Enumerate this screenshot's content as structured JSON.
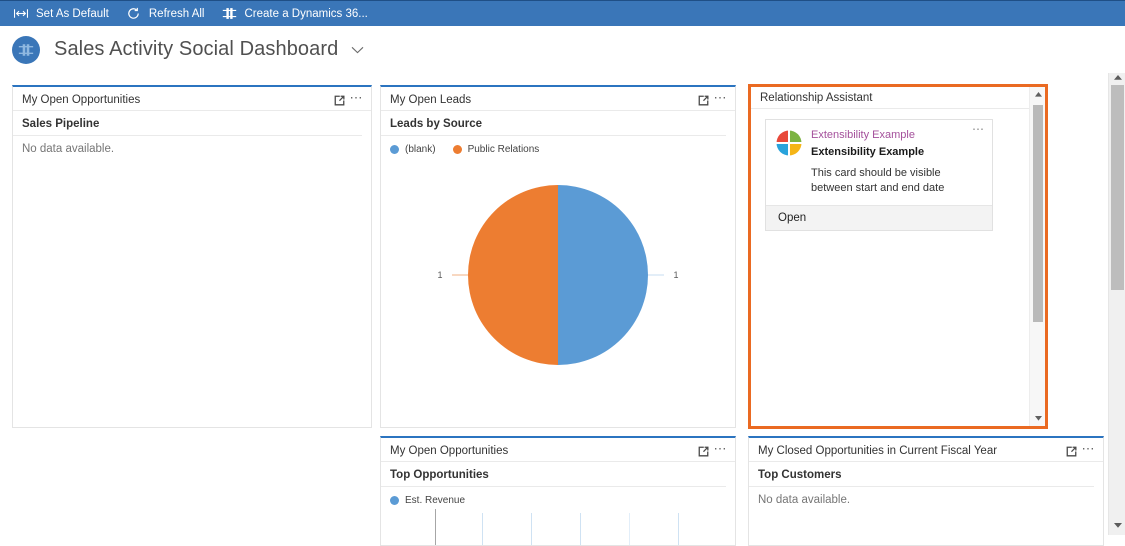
{
  "commandbar": {
    "buttons": [
      {
        "label": "Set As Default",
        "icon": "set-as-default-icon"
      },
      {
        "label": "Refresh All",
        "icon": "refresh-icon"
      },
      {
        "label": "Create a Dynamics 36...",
        "icon": "create-dynamics-icon"
      }
    ]
  },
  "header": {
    "title": "Sales Activity Social Dashboard",
    "avatar_icon": "dashboard-icon",
    "caret_icon": "chevron-down-icon"
  },
  "panels": {
    "open_opportunities_pipeline": {
      "title": "My Open Opportunities",
      "subtitle": "Sales Pipeline",
      "empty_text": "No data available.",
      "expand_icon": "pop-out-icon",
      "more_icon": "more-options-icon"
    },
    "open_leads": {
      "title": "My Open Leads",
      "subtitle": "Leads by Source",
      "expand_icon": "pop-out-icon",
      "more_icon": "more-options-icon"
    },
    "relationship_assistant": {
      "title": "Relationship Assistant",
      "card": {
        "link": "Extensibility Example",
        "subtitle": "Extensibility Example",
        "description": "This card should be visible between start and end date",
        "action_label": "Open",
        "icon": "pinwheel-icon",
        "more_icon": "more-options-icon"
      },
      "scrollbar": {
        "up_icon": "scroll-up-arrow-icon",
        "down_icon": "scroll-down-arrow-icon"
      }
    },
    "top_opportunities": {
      "title": "My Open Opportunities",
      "subtitle": "Top Opportunities",
      "expand_icon": "pop-out-icon",
      "more_icon": "more-options-icon"
    },
    "top_customers": {
      "title": "My Closed Opportunities in Current Fiscal Year",
      "subtitle": "Top Customers",
      "empty_text": "No data available.",
      "expand_icon": "pop-out-icon",
      "more_icon": "more-options-icon"
    }
  },
  "page_scrollbar": {
    "up_icon": "scroll-up-arrow-icon",
    "down_icon": "scroll-down-arrow-icon"
  },
  "colors": {
    "command_bar": "#3a76b8",
    "panel_accent": "#2b74c0",
    "selection": "#ea6a22",
    "series_blue": "#5b9bd5",
    "series_orange": "#ed7d31",
    "link_purple": "#a4509b"
  },
  "chart_data": [
    {
      "type": "pie",
      "title": "Leads by Source",
      "panel": "My Open Leads",
      "categories": [
        "(blank)",
        "Public Relations"
      ],
      "values": [
        1,
        1
      ],
      "colors": [
        "#5b9bd5",
        "#ed7d31"
      ],
      "data_labels": [
        "1",
        "1"
      ],
      "legend": "top",
      "legend_entries": [
        {
          "label": "(blank)",
          "color": "#5b9bd5"
        },
        {
          "label": "Public Relations",
          "color": "#ed7d31"
        }
      ]
    },
    {
      "type": "bar",
      "title": "Top Opportunities",
      "panel": "My Open Opportunities",
      "categories": [],
      "values": [],
      "series": [
        {
          "name": "Est. Revenue",
          "values": []
        }
      ],
      "legend": "top",
      "legend_entries": [
        {
          "label": "Est. Revenue",
          "color": "#5b9bd5"
        }
      ],
      "grid": true,
      "gridline_count": 6,
      "axis_line_color": "#a6a6a6",
      "gridline_color": "#cfe2f3",
      "xlabel": "",
      "ylabel": ""
    }
  ]
}
